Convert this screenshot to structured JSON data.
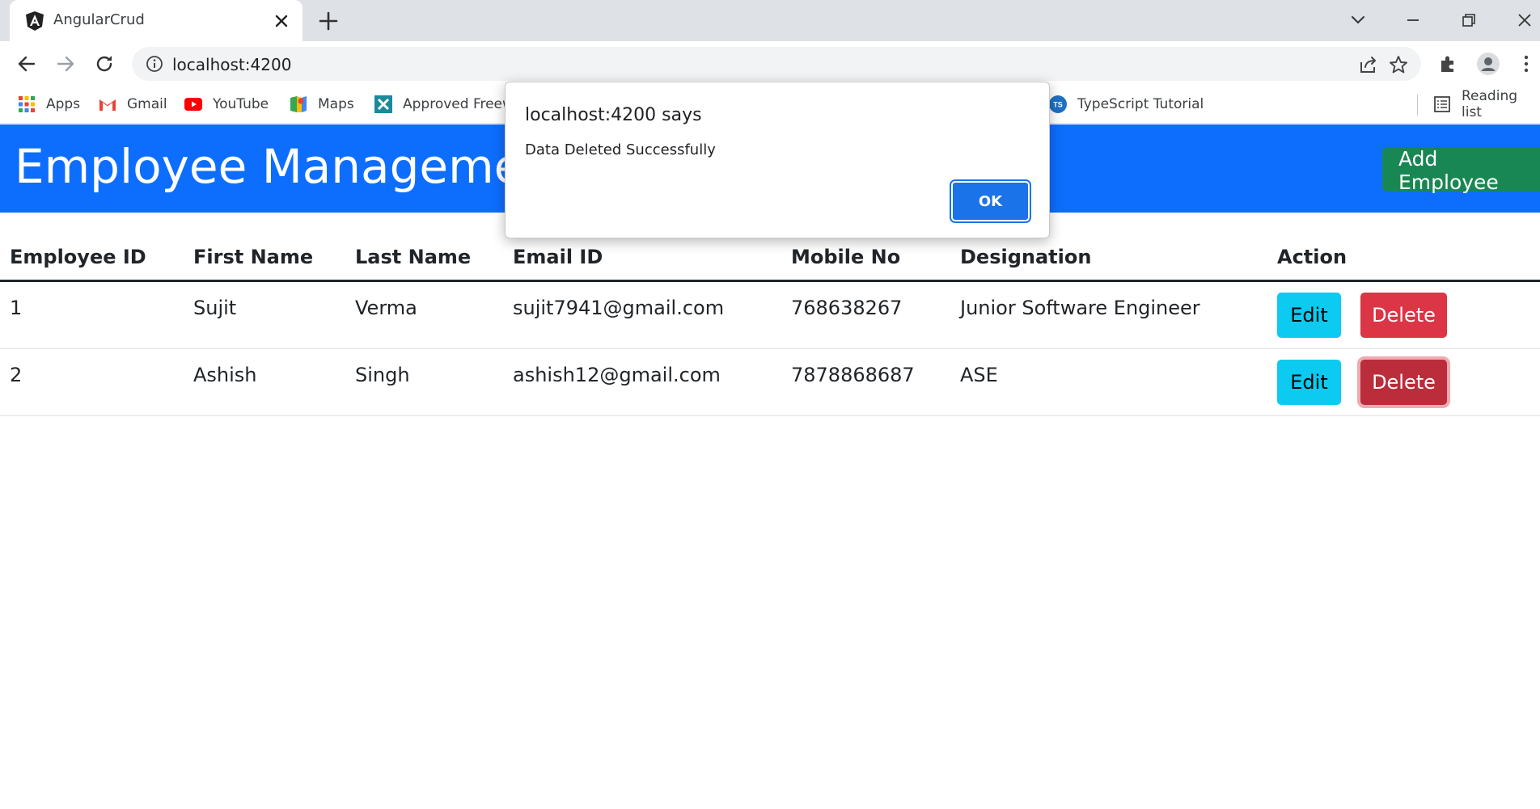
{
  "browser": {
    "tab_title": "AngularCrud",
    "url": "localhost:4200",
    "bookmarks": [
      {
        "label": "Apps",
        "icon": "apps-grid-icon"
      },
      {
        "label": "Gmail",
        "icon": "gmail-icon"
      },
      {
        "label": "YouTube",
        "icon": "youtube-icon"
      },
      {
        "label": "Maps",
        "icon": "maps-icon"
      },
      {
        "label": "Approved Freew",
        "icon": "approved-freeware-icon"
      },
      {
        "label": "TypeScript Tutorial",
        "icon": "typescript-icon"
      }
    ],
    "reading_list": "Reading list"
  },
  "header": {
    "title": "Employee Management",
    "add_button": "Add Employee",
    "color": "#0d6efd"
  },
  "table": {
    "columns": [
      "Employee ID",
      "First Name",
      "Last Name",
      "Email ID",
      "Mobile No",
      "Designation",
      "Action"
    ],
    "rows": [
      {
        "id": "1",
        "first": "Sujit",
        "last": "Verma",
        "email": "sujit7941@gmail.com",
        "mobile": "768638267",
        "designation": "Junior Software Engineer"
      },
      {
        "id": "2",
        "first": "Ashish",
        "last": "Singh",
        "email": "ashish12@gmail.com",
        "mobile": "7878868687",
        "designation": "ASE"
      }
    ],
    "edit_label": "Edit",
    "delete_label": "Delete"
  },
  "dialog": {
    "title": "localhost:4200 says",
    "message": "Data Deleted Successfully",
    "ok_label": "OK"
  },
  "colors": {
    "edit": "#0dcaf0",
    "delete": "#dc3545",
    "add": "#198754",
    "dialog_ok": "#1a73e8"
  }
}
